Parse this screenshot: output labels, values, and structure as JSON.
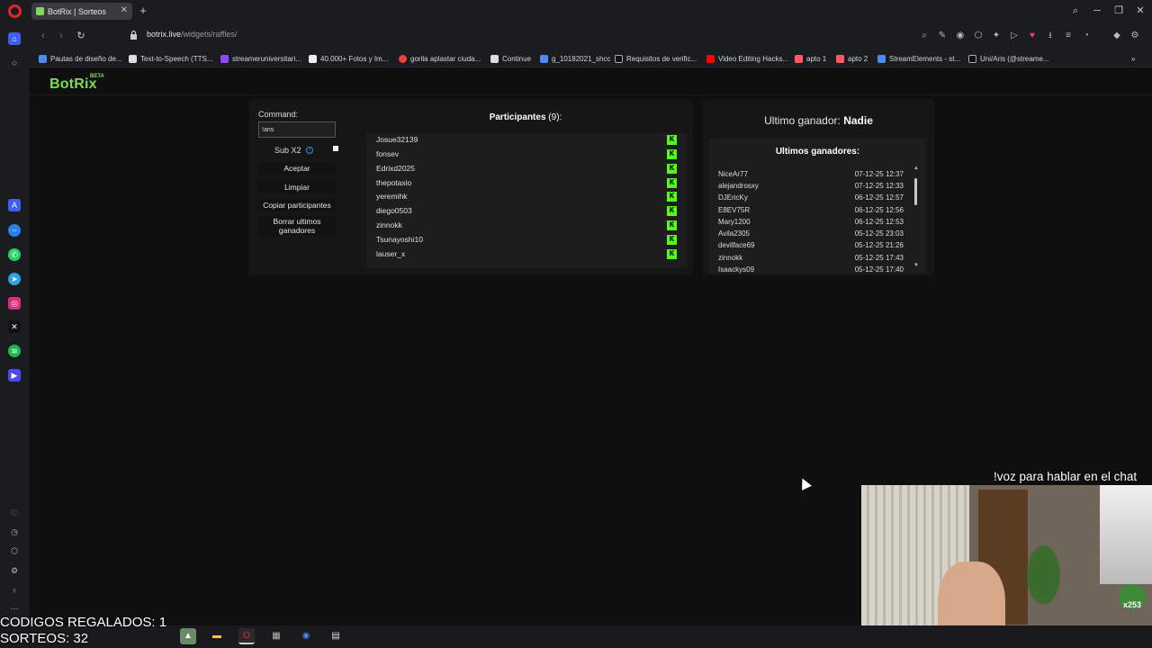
{
  "browser": {
    "tab_title": "BotRix | Sorteos",
    "tab_close": "✕",
    "new_tab": "+",
    "url_host": "botrix.live",
    "url_path": "/widgets/raffles/",
    "bookmarks": [
      "Pautas de diseño de...",
      "Text-to-Speech (TTS...",
      "streameruniversitari...",
      "40.000+ Fotos y Im...",
      "gorila aplastar ciuda...",
      "Continue",
      "g_10182021_shcc",
      "Requisitos de verific...",
      "Video Editing Hacks...",
      "apto 1",
      "apto 2",
      "StreamElements - st...",
      "Uni/Aris (@streame..."
    ]
  },
  "site": {
    "logo": "BotRix",
    "logo_badge": "BETA"
  },
  "raffle": {
    "command_label": "Command:",
    "command_value": "!aris",
    "sub_label": "Sub X2",
    "info_glyph": "i",
    "buttons": {
      "accept": "Aceptar",
      "clear": "Limpiar",
      "copy": "Copiar participantes",
      "delete_winners": "Borrar ultimos ganadores"
    },
    "participants_title": "Participantes",
    "participants_count": "(9):",
    "participants": [
      "Josue32139",
      "fonsev",
      "Edrixd2025",
      "thepotaxio",
      "yeremihk",
      "diego0503",
      "zinnokk",
      "Tsunayoshi10",
      "lauser_x"
    ],
    "platform_glyph": "K",
    "last_winner_label": "Ultimo ganador:",
    "last_winner_value": "Nadie",
    "winners_title": "Ultimos ganadores:",
    "winners": [
      {
        "name": "NiceAr77",
        "date": "07-12-25 12:37"
      },
      {
        "name": "alejandrosxy",
        "date": "07-12-25 12:33"
      },
      {
        "name": "DJEricKy",
        "date": "06-12-25 12:57"
      },
      {
        "name": "E8EV75R",
        "date": "06-12-25 12:56"
      },
      {
        "name": "Mary1200",
        "date": "06-12-25 12:53"
      },
      {
        "name": "Avila2305",
        "date": "05-12-25 23:03"
      },
      {
        "name": "devilface69",
        "date": "05-12-25 21:26"
      },
      {
        "name": "zinnokk",
        "date": "05-12-25 17:43"
      },
      {
        "name": "Isaackys09",
        "date": "05-12-25 17:40"
      }
    ]
  },
  "overlay": {
    "voice_hint": "!voz para hablar en el chat",
    "codes_line": "CODIGOS REGALADOS: 1",
    "raffles_line": "SORTEOS: 32",
    "cam_badge": "x253"
  },
  "colors": {
    "kick_green": "#53fc18",
    "botrix_green": "#7ed957",
    "panel_bg": "#161617"
  }
}
